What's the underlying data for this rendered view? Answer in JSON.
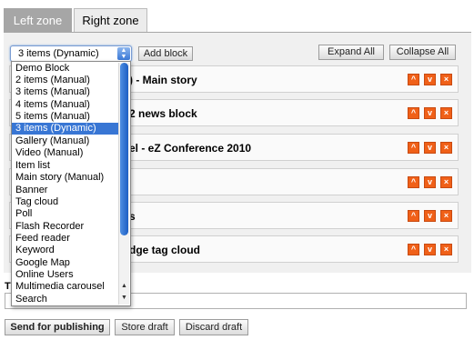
{
  "tabs": [
    {
      "label": "Left zone",
      "active": true
    },
    {
      "label": "Right zone",
      "active": false
    }
  ],
  "toolbar": {
    "block_type_selected": "3 items (Dynamic)",
    "add_block_label": "Add block",
    "expand_all_label": "Expand All",
    "collapse_all_label": "Collapse All"
  },
  "block_type_options": [
    "Demo Block",
    "2 items (Manual)",
    "3 items (Manual)",
    "4 items (Manual)",
    "5 items (Manual)",
    "3 items (Dynamic)",
    "Gallery (Manual)",
    "Video (Manual)",
    "Item list",
    "Main story (Manual)",
    "Banner",
    "Tag cloud",
    "Poll",
    "Flash Recorder",
    "Feed reader",
    "Keyword",
    "Google Map",
    "Online Users",
    "Multimedia carousel",
    "Search"
  ],
  "selected_option_index": 5,
  "blocks": [
    {
      "title": ") - Main story"
    },
    {
      "title": "2 news block"
    },
    {
      "title": "el - eZ Conference 2010"
    },
    {
      "title": ""
    },
    {
      "title": "s"
    },
    {
      "title": "dge tag cloud"
    }
  ],
  "block_controls": {
    "up": "^",
    "down": "v",
    "remove": "×"
  },
  "bottom": {
    "partial_label": "T",
    "send_label": "Send for publishing",
    "store_label": "Store draft",
    "discard_label": "Discard draft"
  },
  "colors": {
    "accent": "#f06018",
    "selection": "#3876d4",
    "tab_active": "#a6a6a6"
  }
}
